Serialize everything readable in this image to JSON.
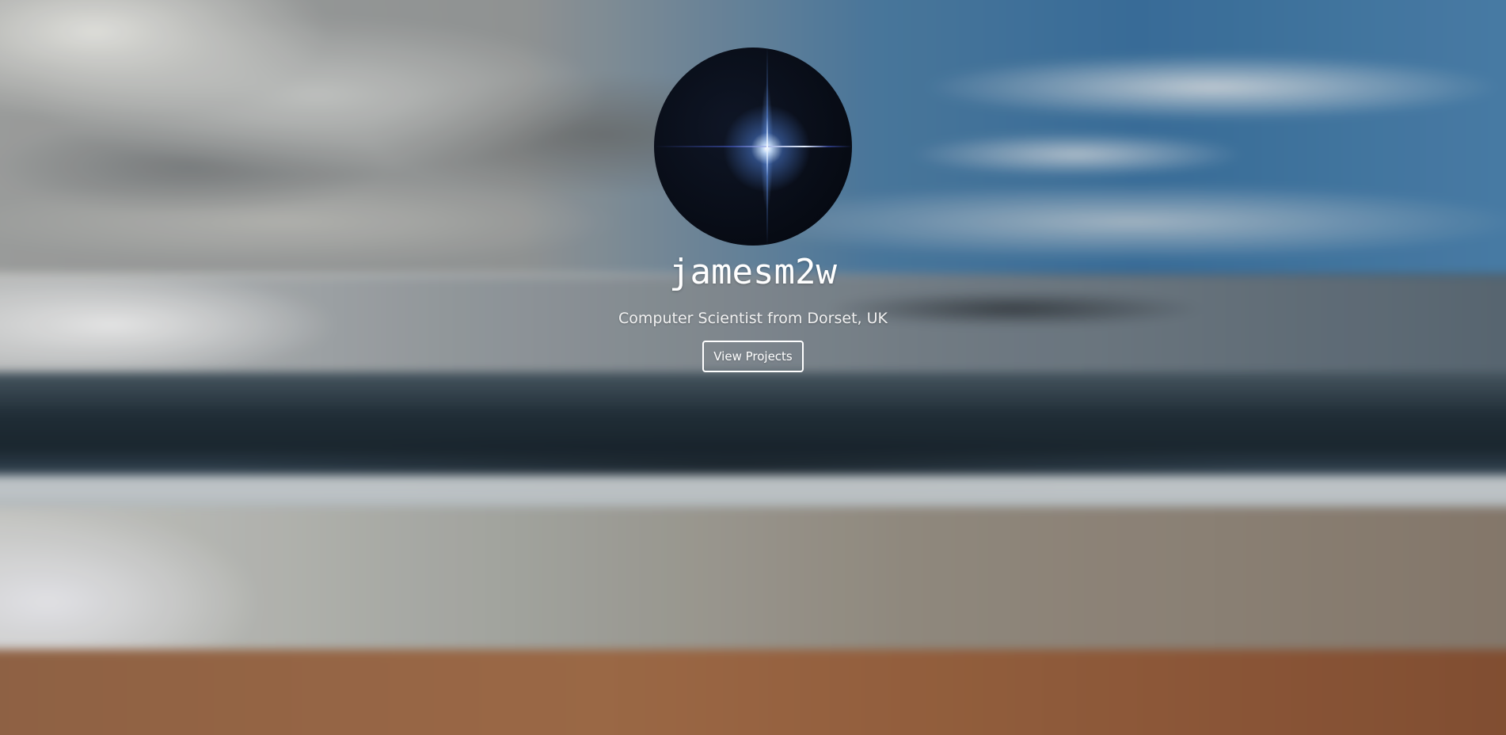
{
  "hero": {
    "title": "jamesm2w",
    "subtitle": "Computer Scientist from Dorset, UK",
    "button_label": "View Projects"
  },
  "colors": {
    "text": "#ffffff",
    "button_border": "#ffffff"
  },
  "icons": {
    "avatar": "star-flare-avatar"
  }
}
